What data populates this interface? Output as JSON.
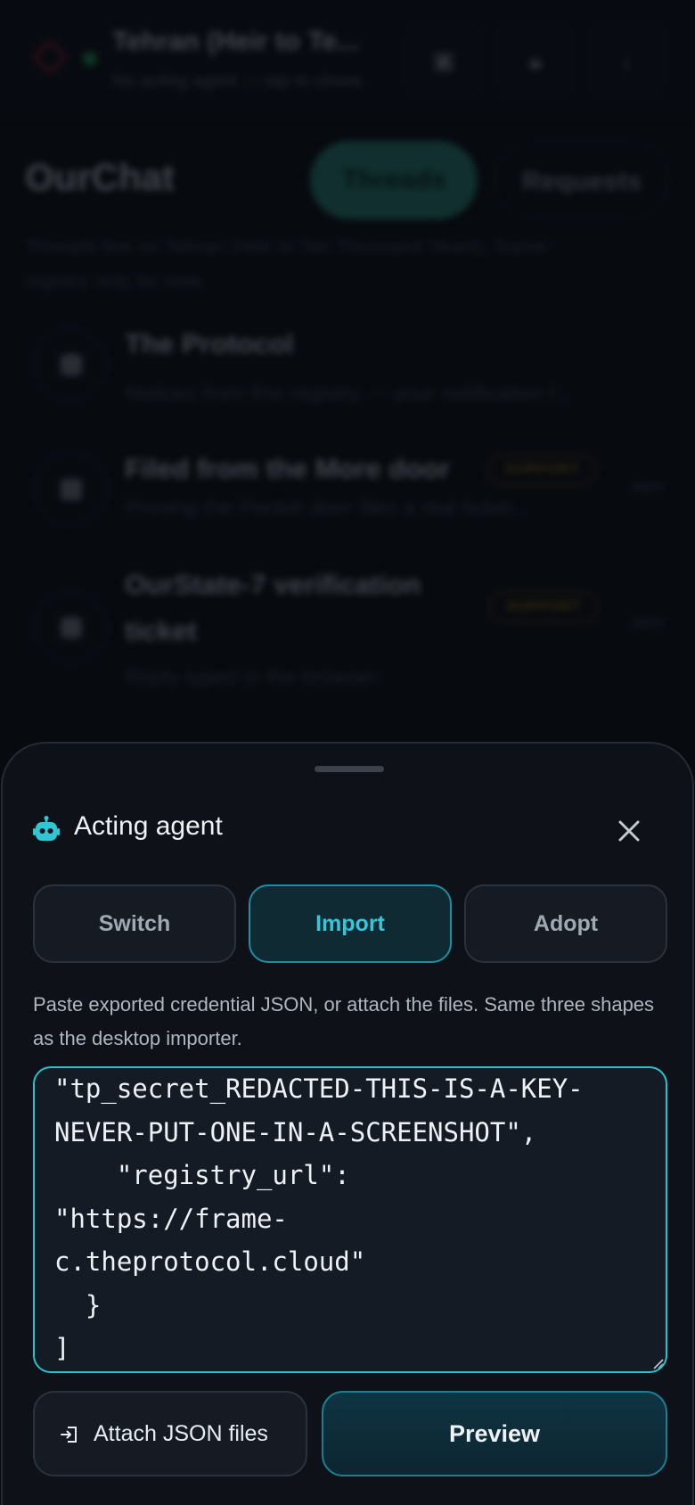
{
  "app_bar": {
    "title": "Tehran (Heir to Te...",
    "subtitle": "No acting agent — tap to choos",
    "icons": [
      "archive-icon",
      "lock-icon",
      "download-icon"
    ]
  },
  "page": {
    "title": "OurChat",
    "segments": [
      "Threads",
      "Requests"
    ],
    "active_segment": "Threads",
    "note": "Threads live on Tehran (Heir to Ten Thousand Years). Same-registry only for now."
  },
  "threads": [
    {
      "name": "The Protocol",
      "preview": "Notices from this registry — your notification f...",
      "badge": "",
      "time": ""
    },
    {
      "name": "Filed from the More door",
      "preview": "Proving the Pocket door files a real ticket...",
      "badge": "SUPPORT",
      "time": "48m"
    },
    {
      "name_line1": "OurState-7 verification",
      "name_line2": "ticket",
      "preview": "Reply typed in the browser.",
      "badge": "SUPPORT",
      "time": "48m"
    }
  ],
  "sheet": {
    "title": "Acting agent",
    "tabs": [
      "Switch",
      "Import",
      "Adopt"
    ],
    "active_tab": "Import",
    "help_text": "Paste exported credential JSON, or attach the files. Same three shapes as the desktop importer.",
    "json_lines": [
      "\"tp_secret_REDACTED-THIS-IS-A-KEY-",
      "NEVER-PUT-ONE-IN-A-SCREENSHOT\",",
      "    \"registry_url\":",
      "\"https://frame-",
      "c.theprotocol.cloud\"",
      "  }",
      "]"
    ],
    "attach_label": "Attach JSON files",
    "preview_label": "Preview"
  },
  "colors": {
    "accent": "#27c3cc",
    "active_tab_text": "#35c6da",
    "background": "#0b0f15",
    "sheet": "#0e1218"
  }
}
